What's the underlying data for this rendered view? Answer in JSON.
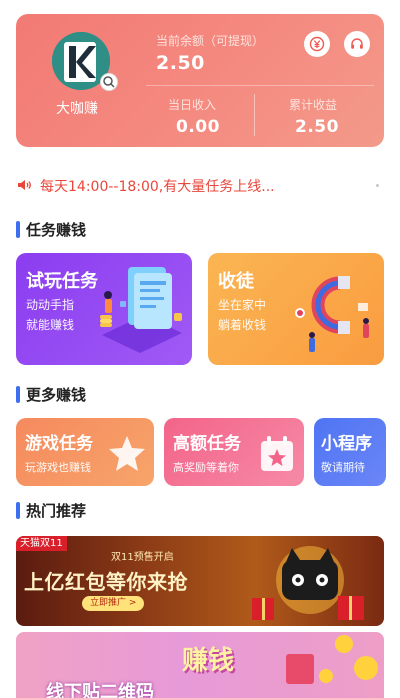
{
  "header": {
    "username": "大咖赚",
    "balance_label": "当前余额（可提现）",
    "balance_value": "2.50",
    "today_label": "当日收入",
    "today_value": "0.00",
    "total_label": "累计收益",
    "total_value": "2.50"
  },
  "notice": {
    "text": "每天14:00--18:00,有大量任务上线..."
  },
  "sections": {
    "tasks": "任务赚钱",
    "more": "更多赚钱",
    "hot": "热门推荐"
  },
  "task_cards": [
    {
      "title": "试玩任务",
      "line1": "动动手指",
      "line2": "就能赚钱"
    },
    {
      "title": "收徒",
      "line1": "坐在家中",
      "line2": "躺着收钱"
    }
  ],
  "more_cards": [
    {
      "title": "游戏任务",
      "subtitle": "玩游戏也赚钱"
    },
    {
      "title": "高额任务",
      "subtitle": "高奖励等着你"
    },
    {
      "title": "小程序",
      "subtitle": "敬请期待"
    }
  ],
  "banners": {
    "b1_tag": "天猫双11",
    "b1_pre": "双11预售开启",
    "b1_headline": "上亿红包等你来抢",
    "b1_cta": "立即推广 >",
    "b2_headline": "线下贴二维码",
    "b2_earn": "赚钱"
  },
  "colors": {
    "header_gradient_start": "#f27a74",
    "notice_red": "#e8473b",
    "section_bar_blue": "#3d6ef2",
    "trial_purple": "#8b3df0",
    "recruit_orange": "#fbb552",
    "game_orange": "#f58a5e",
    "high_pink": "#f3648a",
    "mini_blue": "#4f74f3"
  },
  "icons": {
    "withdraw": "yuan-coin-icon",
    "service": "headset-icon",
    "notice": "speaker-icon"
  }
}
